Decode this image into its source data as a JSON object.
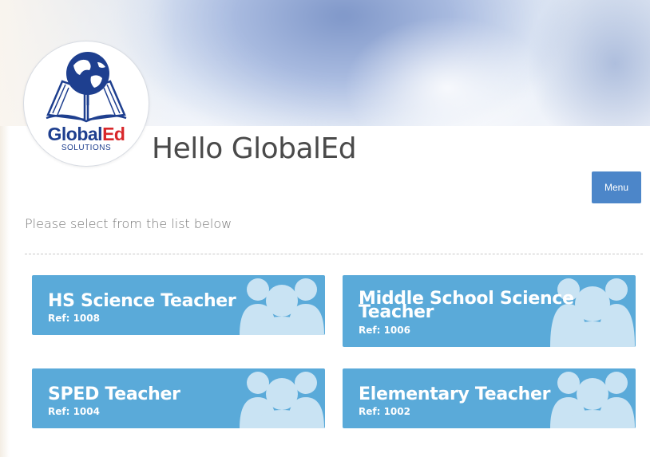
{
  "header": {
    "greeting": "Hello GlobalEd",
    "menu_label": "Menu"
  },
  "logo": {
    "name_part1": "Global",
    "name_part2": "Ed",
    "tagline": "SOLUTIONS"
  },
  "main": {
    "instruction": "Please select from the list below",
    "jobs": [
      {
        "title": "HS Science Teacher",
        "ref": "Ref: 1008"
      },
      {
        "title": "Middle School Science",
        "title_line2": "Teacher",
        "ref": "Ref: 1006"
      },
      {
        "title": "SPED Teacher",
        "ref": "Ref: 1004"
      },
      {
        "title": "Elementary Teacher",
        "ref": "Ref: 1002"
      }
    ]
  },
  "icons": {
    "job_card_icon": "group-people-icon",
    "logo_icon": "globe-book-icon"
  },
  "colors": {
    "card_background": "#5aaad9",
    "card_icon": "#c9e3f3",
    "menu_button": "#4c86c9",
    "logo_blue": "#1e3f8f",
    "logo_red": "#d8272a",
    "title_text": "#4a4a4a"
  }
}
